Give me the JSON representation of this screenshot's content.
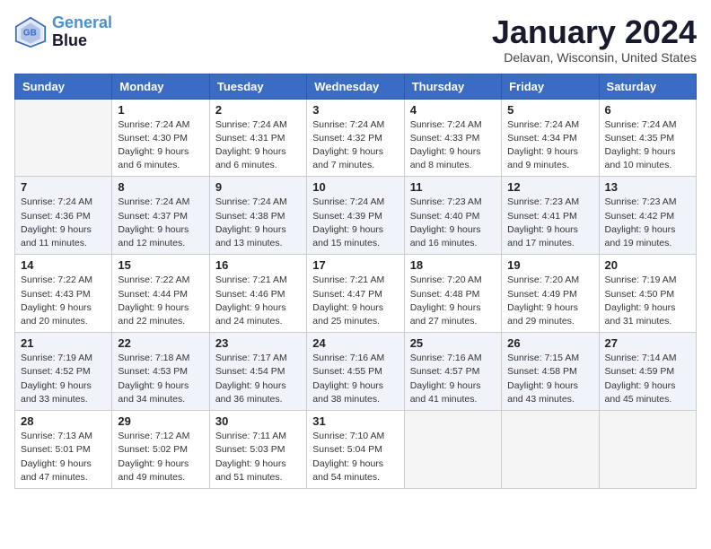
{
  "header": {
    "logo_line1": "General",
    "logo_line2": "Blue",
    "month_title": "January 2024",
    "location": "Delavan, Wisconsin, United States"
  },
  "weekdays": [
    "Sunday",
    "Monday",
    "Tuesday",
    "Wednesday",
    "Thursday",
    "Friday",
    "Saturday"
  ],
  "weeks": [
    [
      {
        "day": "",
        "sunrise": "",
        "sunset": "",
        "daylight": ""
      },
      {
        "day": "1",
        "sunrise": "Sunrise: 7:24 AM",
        "sunset": "Sunset: 4:30 PM",
        "daylight": "Daylight: 9 hours and 6 minutes."
      },
      {
        "day": "2",
        "sunrise": "Sunrise: 7:24 AM",
        "sunset": "Sunset: 4:31 PM",
        "daylight": "Daylight: 9 hours and 6 minutes."
      },
      {
        "day": "3",
        "sunrise": "Sunrise: 7:24 AM",
        "sunset": "Sunset: 4:32 PM",
        "daylight": "Daylight: 9 hours and 7 minutes."
      },
      {
        "day": "4",
        "sunrise": "Sunrise: 7:24 AM",
        "sunset": "Sunset: 4:33 PM",
        "daylight": "Daylight: 9 hours and 8 minutes."
      },
      {
        "day": "5",
        "sunrise": "Sunrise: 7:24 AM",
        "sunset": "Sunset: 4:34 PM",
        "daylight": "Daylight: 9 hours and 9 minutes."
      },
      {
        "day": "6",
        "sunrise": "Sunrise: 7:24 AM",
        "sunset": "Sunset: 4:35 PM",
        "daylight": "Daylight: 9 hours and 10 minutes."
      }
    ],
    [
      {
        "day": "7",
        "sunrise": "Sunrise: 7:24 AM",
        "sunset": "Sunset: 4:36 PM",
        "daylight": "Daylight: 9 hours and 11 minutes."
      },
      {
        "day": "8",
        "sunrise": "Sunrise: 7:24 AM",
        "sunset": "Sunset: 4:37 PM",
        "daylight": "Daylight: 9 hours and 12 minutes."
      },
      {
        "day": "9",
        "sunrise": "Sunrise: 7:24 AM",
        "sunset": "Sunset: 4:38 PM",
        "daylight": "Daylight: 9 hours and 13 minutes."
      },
      {
        "day": "10",
        "sunrise": "Sunrise: 7:24 AM",
        "sunset": "Sunset: 4:39 PM",
        "daylight": "Daylight: 9 hours and 15 minutes."
      },
      {
        "day": "11",
        "sunrise": "Sunrise: 7:23 AM",
        "sunset": "Sunset: 4:40 PM",
        "daylight": "Daylight: 9 hours and 16 minutes."
      },
      {
        "day": "12",
        "sunrise": "Sunrise: 7:23 AM",
        "sunset": "Sunset: 4:41 PM",
        "daylight": "Daylight: 9 hours and 17 minutes."
      },
      {
        "day": "13",
        "sunrise": "Sunrise: 7:23 AM",
        "sunset": "Sunset: 4:42 PM",
        "daylight": "Daylight: 9 hours and 19 minutes."
      }
    ],
    [
      {
        "day": "14",
        "sunrise": "Sunrise: 7:22 AM",
        "sunset": "Sunset: 4:43 PM",
        "daylight": "Daylight: 9 hours and 20 minutes."
      },
      {
        "day": "15",
        "sunrise": "Sunrise: 7:22 AM",
        "sunset": "Sunset: 4:44 PM",
        "daylight": "Daylight: 9 hours and 22 minutes."
      },
      {
        "day": "16",
        "sunrise": "Sunrise: 7:21 AM",
        "sunset": "Sunset: 4:46 PM",
        "daylight": "Daylight: 9 hours and 24 minutes."
      },
      {
        "day": "17",
        "sunrise": "Sunrise: 7:21 AM",
        "sunset": "Sunset: 4:47 PM",
        "daylight": "Daylight: 9 hours and 25 minutes."
      },
      {
        "day": "18",
        "sunrise": "Sunrise: 7:20 AM",
        "sunset": "Sunset: 4:48 PM",
        "daylight": "Daylight: 9 hours and 27 minutes."
      },
      {
        "day": "19",
        "sunrise": "Sunrise: 7:20 AM",
        "sunset": "Sunset: 4:49 PM",
        "daylight": "Daylight: 9 hours and 29 minutes."
      },
      {
        "day": "20",
        "sunrise": "Sunrise: 7:19 AM",
        "sunset": "Sunset: 4:50 PM",
        "daylight": "Daylight: 9 hours and 31 minutes."
      }
    ],
    [
      {
        "day": "21",
        "sunrise": "Sunrise: 7:19 AM",
        "sunset": "Sunset: 4:52 PM",
        "daylight": "Daylight: 9 hours and 33 minutes."
      },
      {
        "day": "22",
        "sunrise": "Sunrise: 7:18 AM",
        "sunset": "Sunset: 4:53 PM",
        "daylight": "Daylight: 9 hours and 34 minutes."
      },
      {
        "day": "23",
        "sunrise": "Sunrise: 7:17 AM",
        "sunset": "Sunset: 4:54 PM",
        "daylight": "Daylight: 9 hours and 36 minutes."
      },
      {
        "day": "24",
        "sunrise": "Sunrise: 7:16 AM",
        "sunset": "Sunset: 4:55 PM",
        "daylight": "Daylight: 9 hours and 38 minutes."
      },
      {
        "day": "25",
        "sunrise": "Sunrise: 7:16 AM",
        "sunset": "Sunset: 4:57 PM",
        "daylight": "Daylight: 9 hours and 41 minutes."
      },
      {
        "day": "26",
        "sunrise": "Sunrise: 7:15 AM",
        "sunset": "Sunset: 4:58 PM",
        "daylight": "Daylight: 9 hours and 43 minutes."
      },
      {
        "day": "27",
        "sunrise": "Sunrise: 7:14 AM",
        "sunset": "Sunset: 4:59 PM",
        "daylight": "Daylight: 9 hours and 45 minutes."
      }
    ],
    [
      {
        "day": "28",
        "sunrise": "Sunrise: 7:13 AM",
        "sunset": "Sunset: 5:01 PM",
        "daylight": "Daylight: 9 hours and 47 minutes."
      },
      {
        "day": "29",
        "sunrise": "Sunrise: 7:12 AM",
        "sunset": "Sunset: 5:02 PM",
        "daylight": "Daylight: 9 hours and 49 minutes."
      },
      {
        "day": "30",
        "sunrise": "Sunrise: 7:11 AM",
        "sunset": "Sunset: 5:03 PM",
        "daylight": "Daylight: 9 hours and 51 minutes."
      },
      {
        "day": "31",
        "sunrise": "Sunrise: 7:10 AM",
        "sunset": "Sunset: 5:04 PM",
        "daylight": "Daylight: 9 hours and 54 minutes."
      },
      {
        "day": "",
        "sunrise": "",
        "sunset": "",
        "daylight": ""
      },
      {
        "day": "",
        "sunrise": "",
        "sunset": "",
        "daylight": ""
      },
      {
        "day": "",
        "sunrise": "",
        "sunset": "",
        "daylight": ""
      }
    ]
  ]
}
